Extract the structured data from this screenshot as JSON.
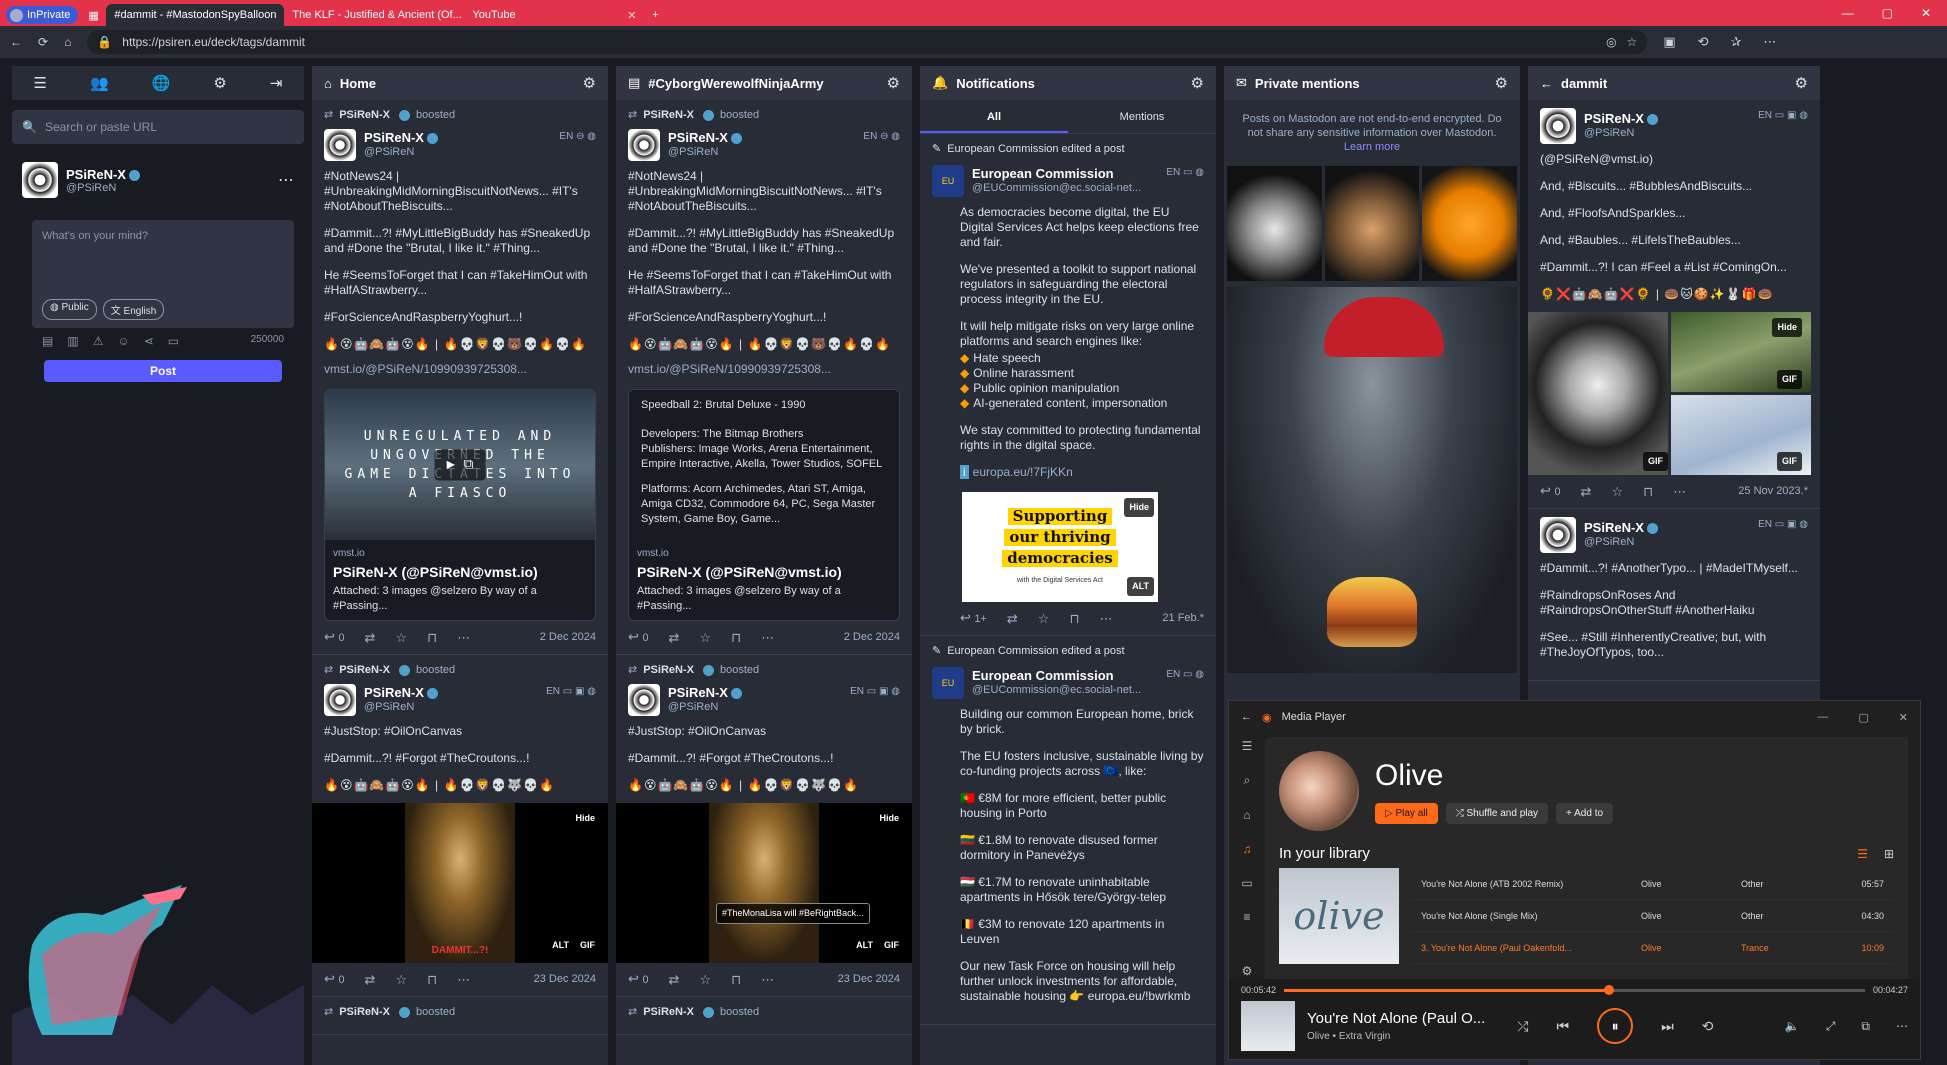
{
  "browser": {
    "private_label": "InPrivate",
    "tabs": [
      {
        "label": "#dammit - #MastodonSpyBalloon"
      },
      {
        "label": "The KLF - Justified & Ancient (Of..."
      },
      {
        "label": "YouTube"
      }
    ],
    "url": "https://psiren.eu/deck/tags/dammit"
  },
  "nav": {
    "search_placeholder": "Search or paste URL",
    "user_name": "PSiReN-X",
    "user_handle": "@PSiReN",
    "compose_placeholder": "What's on your mind?",
    "visibility": "Public",
    "language": "English",
    "char_count": "250000",
    "post_label": "Post"
  },
  "columns": {
    "home": {
      "title": "Home"
    },
    "cyborg": {
      "title": "#CyborgWerewolfNinjaArmy"
    },
    "notifications": {
      "title": "Notifications",
      "tab_all": "All",
      "tab_mentions": "Mentions"
    },
    "private": {
      "title": "Private mentions",
      "note": "Posts on Mastodon are not end-to-end encrypted. Do not share any sensitive information over Mastodon.",
      "learn_more": "Learn more"
    },
    "dammit": {
      "title": "dammit"
    }
  },
  "post1": {
    "boosted_by": "PSiReN-X",
    "boosted": "boosted",
    "name": "PSiReN-X",
    "handle": "@PSiReN",
    "lang": "EN",
    "p1": "#NotNews24 | #UnbreakingMidMorningBiscuitNotNews... #IT's #NotAboutTheBiscuits...",
    "p2": "#Dammit...?! #MyLittleBigBuddy has #SneakedUp and #Done the \"Brutal, I like it.\" #Thing...",
    "p3": "He #SeemsToForget that I can #TakeHimOut with #HalfAStrawberry...",
    "p4": "#ForScienceAndRaspberryYoghurt...!",
    "emoji": "🔥😵🤖🙈🤖😵🔥 | 🔥💀🦁💀🐻💀🔥💀🔥",
    "link": "vmst.io/@PSiReN/10990939725308...",
    "card_provider": "vmst.io",
    "card_title": "PSiReN-X (@PSiReN@vmst.io)",
    "card_desc": "Attached: 3 images @selzero By way of a #Passing...",
    "card_image_text": "UNREGULATED AND UNGOVERNED THE GAME DICTATES INTO A FIASCO",
    "card2_title": "Speedball 2: Brutal Deluxe - 1990",
    "card2_dev": "Developers: The Bitmap Brothers",
    "card2_pub": "Publishers: Image Works, Arena Entertainment, Empire Interactive, Akella, Tower Studios, SOFEL",
    "card2_plat": "Platforms: Acorn Archimedes, Atari ST, Amiga, Amiga CD32, Commodore 64, PC, Sega Master System, Game Boy, Game...",
    "replies": "0",
    "date": "2 Dec 2024"
  },
  "post2": {
    "boosted_by": "PSiReN-X",
    "boosted": "boosted",
    "name": "PSiReN-X",
    "handle": "@PSiReN",
    "lang": "EN",
    "p1": "#JustStop: #OilOnCanvas",
    "p2": "#Dammit...?! #Forgot #TheCroutons...!",
    "emoji": "🔥😵🤖🙈🤖😵🔥 | 🔥💀🦁💀🐺💀🔥",
    "hide": "Hide",
    "alt": "ALT",
    "gif": "GIF",
    "tooltip": "#TheMonaLisa will #BeRightBack...",
    "mona_caption": "DAMMIT...?!",
    "replies": "0",
    "date": "23 Dec 2024"
  },
  "post3_prepend": {
    "name": "PSiReN-X",
    "boosted": "boosted"
  },
  "notif": {
    "edited1": "European Commission edited a post",
    "name": "European Commission",
    "handle": "@EUCommission@ec.social-net...",
    "lang": "EN",
    "avatar": "EU",
    "p1": "As democracies become digital, the EU Digital Services Act helps keep elections free and fair.",
    "p2": "We've presented a toolkit to support national regulators in safeguarding the electoral process integrity in the EU.",
    "p3": "It will help mitigate risks on very large online platforms and search engines like:",
    "bullets": [
      "Hate speech",
      "Online harassment",
      "Public opinion manipulation",
      "AI-generated content, impersonation"
    ],
    "p4": "We stay committed to protecting fundamental rights in the digital space.",
    "link": "europa.eu/!7FjKKn",
    "img_l1": "Supporting",
    "img_l2": "our thriving",
    "img_l3": "democracies",
    "img_small": "with the Digital Services Act",
    "hide": "Hide",
    "alt": "ALT",
    "replies": "1+",
    "date": "21 Feb.*",
    "edited2": "European Commission edited a post",
    "q1": "Building our common European home, brick by brick.",
    "q2": "The EU fosters inclusive, sustainable living by co-funding projects across 🇪🇺, like:",
    "q3": "🇵🇹 €8M for more efficient, better public housing in Porto",
    "q4": "🇱🇹 €1.8M to renovate disused former dormitory in Panevėžys",
    "q5": "🇭🇺 €1.7M to renovate uninhabitable apartments in Hősök tere/György-telep",
    "q6": "🇧🇪 €3M to renovate 120 apartments in Leuven",
    "q7": "Our new Task Force on housing will help further unlock investments for affordable, sustainable housing 👉 europa.eu/!bwrkmb"
  },
  "dammit_post": {
    "name": "PSiReN-X",
    "handle": "@PSiReN",
    "lang": "EN",
    "mention": "(@PSiReN@vmst.io)",
    "p1": "And, #Biscuits... #BubblesAndBiscuits...",
    "p2": "And, #FloofsAndSparkles...",
    "p3": "And, #Baubles... #LifeIsTheBaubles...",
    "p4": "#Dammit...?! I can #Feel a #List #ComingOn...",
    "emoji": "🌻❌🤖🙈🤖❌🌻 | 🍩🐱🍪✨🐰🎁🍩",
    "hide": "Hide",
    "gif": "GIF",
    "replies": "0",
    "date": "25 Nov 2023.*",
    "p5": "#Dammit...?! #AnotherTypo... | #MadeITMyself...",
    "p6": "#RaindropsOnRoses And #RaindropsOnOtherStuff #AnotherHaiku",
    "p7": "#See... #Still #InherentlyCreative; but, with #TheJoyOfTypos, too..."
  },
  "media_player": {
    "title": "Media Player",
    "artist": "Olive",
    "play_all": "Play all",
    "shuffle": "Shuffle and play",
    "add_to": "Add to",
    "library": "In your library",
    "album_art_text": "olive",
    "tracks": [
      {
        "title": "You're Not Alone (ATB 2002 Remix)",
        "artist": "Olive",
        "genre": "Other",
        "dur": "05:57"
      },
      {
        "title": "You're Not Alone (Single Mix)",
        "artist": "Olive",
        "genre": "Other",
        "dur": "04:30"
      },
      {
        "title": "3. You're Not Alone (Paul Oakenfold...",
        "artist": "Olive",
        "genre": "Trance",
        "dur": "10:09"
      }
    ],
    "elapsed": "00:05:42",
    "remaining": "00:04:27",
    "progress": 0.56,
    "now_title": "You're Not Alone (Paul O...",
    "now_sub": "Olive • Extra Virgin"
  }
}
